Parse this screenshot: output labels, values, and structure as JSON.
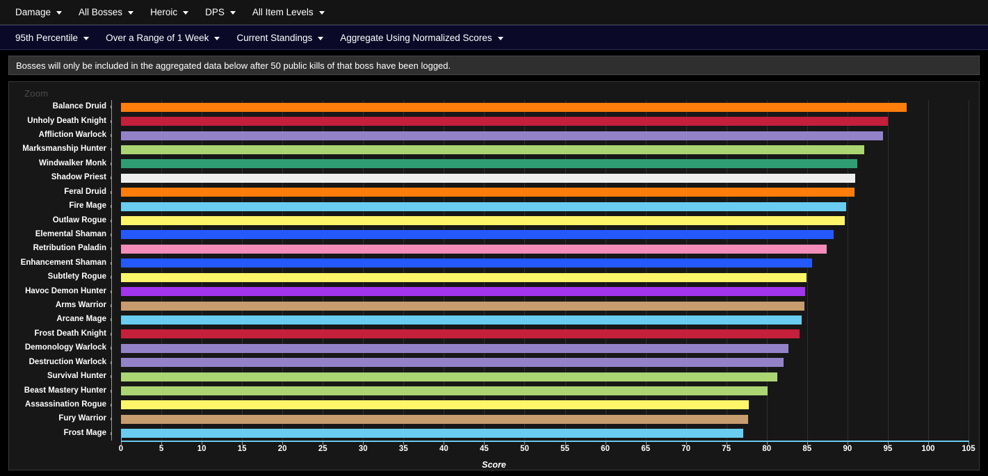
{
  "toolbar_primary": {
    "items": [
      {
        "label": "Damage",
        "name": "menu-damage"
      },
      {
        "label": "All Bosses",
        "name": "menu-all-bosses"
      },
      {
        "label": "Heroic",
        "name": "menu-heroic"
      },
      {
        "label": "DPS",
        "name": "menu-dps"
      },
      {
        "label": "All Item Levels",
        "name": "menu-all-item-levels"
      }
    ]
  },
  "toolbar_secondary": {
    "items": [
      {
        "label": "95th Percentile",
        "name": "menu-percentile"
      },
      {
        "label": "Over a Range of 1 Week",
        "name": "menu-time-range"
      },
      {
        "label": "Current Standings",
        "name": "menu-standings"
      },
      {
        "label": "Aggregate Using Normalized Scores",
        "name": "menu-aggregate"
      }
    ]
  },
  "notice": {
    "text": "Bosses will only be included in the aggregated data below after 50 public kills of that boss have been logged."
  },
  "chart_panel": {
    "zoom_label": "Zoom"
  },
  "chart_data": {
    "type": "bar",
    "orientation": "horizontal",
    "title": "",
    "xlabel": "Score",
    "ylabel": "",
    "xlim": [
      0,
      105
    ],
    "xticks": [
      0,
      5,
      10,
      15,
      20,
      25,
      30,
      35,
      40,
      45,
      50,
      55,
      60,
      65,
      70,
      75,
      80,
      85,
      90,
      95,
      100,
      105
    ],
    "grid": true,
    "legend": "none",
    "categories": [
      "Balance Druid",
      "Unholy Death Knight",
      "Affliction Warlock",
      "Marksmanship Hunter",
      "Windwalker Monk",
      "Shadow Priest",
      "Feral Druid",
      "Fire Mage",
      "Outlaw Rogue",
      "Elemental Shaman",
      "Retribution Paladin",
      "Enhancement Shaman",
      "Subtlety Rogue",
      "Havoc Demon Hunter",
      "Arms Warrior",
      "Arcane Mage",
      "Frost Death Knight",
      "Demonology Warlock",
      "Destruction Warlock",
      "Survival Hunter",
      "Beast Mastery Hunter",
      "Assassination Rogue",
      "Fury Warrior",
      "Frost Mage"
    ],
    "values": [
      97.3,
      95.0,
      94.4,
      92.1,
      91.2,
      91.0,
      90.9,
      89.8,
      89.7,
      88.3,
      87.4,
      85.6,
      84.9,
      84.8,
      84.7,
      84.3,
      84.1,
      82.7,
      82.1,
      81.3,
      80.1,
      77.8,
      77.7,
      77.1
    ],
    "colors": [
      "#FF7D0A",
      "#C41F3B",
      "#9482C9",
      "#ABD473",
      "#2E9D74",
      "#EEEEEE",
      "#FF7D0A",
      "#69CCF0",
      "#FFF569",
      "#2459FF",
      "#F58CBA",
      "#2459FF",
      "#FFF569",
      "#A335EE",
      "#C79C6E",
      "#69CCF0",
      "#C41F3B",
      "#9482C9",
      "#9482C9",
      "#ABD473",
      "#ABD473",
      "#FFF569",
      "#C79C6E",
      "#69CCF0"
    ]
  }
}
